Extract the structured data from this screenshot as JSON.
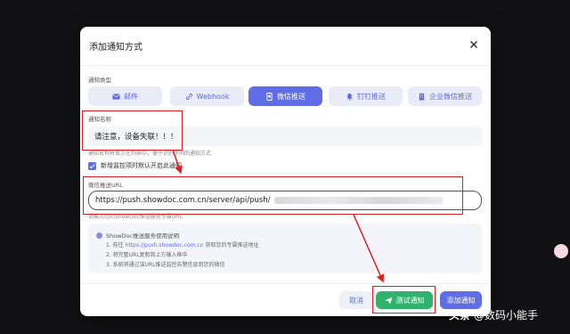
{
  "modal": {
    "title": "添加通知方式",
    "close_icon": "close-icon"
  },
  "notify_type": {
    "label": "通知类型",
    "tabs": [
      {
        "label": "邮件",
        "icon": "mail-icon",
        "active": false
      },
      {
        "label": "Webhook",
        "icon": "link-icon",
        "active": false
      },
      {
        "label": "微信推送",
        "icon": "wechat-icon",
        "active": true
      },
      {
        "label": "钉钉推送",
        "icon": "bell-icon",
        "active": false
      },
      {
        "label": "企业微信推送",
        "icon": "building-icon",
        "active": false
      }
    ]
  },
  "notify_name": {
    "label": "通知名称",
    "value": "请注意，设备失联！！！",
    "hint": "通知名称将显示在列表中，便于识别不同的通知方式"
  },
  "default_enable": {
    "label": "新增监控项时默认开启此通知",
    "checked": true
  },
  "wechat_url": {
    "label": "微信推送URL",
    "value": "https://push.showdoc.com.cn/server/api/push/",
    "hint": "请输入您的ShowDoc推送服务专属URL"
  },
  "info": {
    "title": "ShowDoc推送服务使用说明",
    "lines": [
      {
        "prefix": "1. 前往 ",
        "link": "https://push.showdoc.com.cn",
        "suffix": " 获取您的专属推送地址"
      },
      {
        "prefix": "2. 将完整URL复制到上方输入框中",
        "link": "",
        "suffix": ""
      },
      {
        "prefix": "3. 系统将通过该URL推送监控告警信息到您的微信",
        "link": "",
        "suffix": ""
      }
    ]
  },
  "footer": {
    "cancel_label": "取消",
    "test_label": "测试通知",
    "add_label": "添加通知"
  },
  "watermark": {
    "brand": "头条",
    "handle": "@数码小能手"
  },
  "colors": {
    "primary": "#5f6ee6",
    "success": "#2fb36c",
    "annotation": "#e02020"
  }
}
